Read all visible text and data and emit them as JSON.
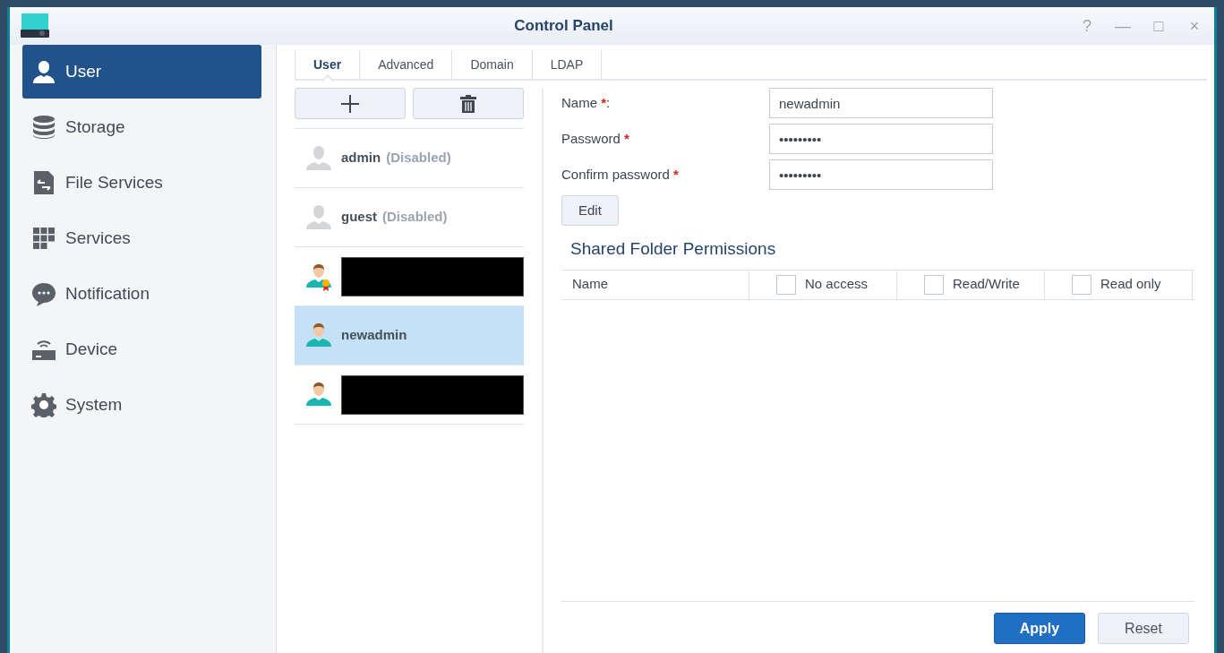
{
  "window": {
    "title": "Control Panel",
    "controls": [
      "?",
      "—",
      "□",
      "×"
    ]
  },
  "sidebar": {
    "items": [
      {
        "label": "User",
        "selected": true
      },
      {
        "label": "Storage",
        "selected": false
      },
      {
        "label": "File Services",
        "selected": false
      },
      {
        "label": "Services",
        "selected": false
      },
      {
        "label": "Notification",
        "selected": false
      },
      {
        "label": "Device",
        "selected": false
      },
      {
        "label": "System",
        "selected": false
      }
    ]
  },
  "tabs": [
    {
      "label": "User",
      "selected": true
    },
    {
      "label": "Advanced",
      "selected": false
    },
    {
      "label": "Domain",
      "selected": false
    },
    {
      "label": "LDAP",
      "selected": false
    }
  ],
  "users": [
    {
      "kind": "named",
      "name": "admin",
      "status": "(Disabled)",
      "enabled": false,
      "admin_badge": false,
      "selected": false
    },
    {
      "kind": "named",
      "name": "guest",
      "status": "(Disabled)",
      "enabled": false,
      "admin_badge": false,
      "selected": false
    },
    {
      "kind": "redacted",
      "enabled": true,
      "admin_badge": true,
      "selected": false
    },
    {
      "kind": "named",
      "name": "newadmin",
      "enabled": true,
      "admin_badge": false,
      "selected": true
    },
    {
      "kind": "redacted",
      "enabled": true,
      "admin_badge": false,
      "selected": false
    }
  ],
  "form": {
    "fields": [
      {
        "label": "Name",
        "required_mark": "*",
        "suffix": ":",
        "value": "newadmin"
      },
      {
        "label": "Password",
        "required_mark": "*",
        "value": "•••••••••"
      },
      {
        "label": "Confirm password",
        "required_mark": "*",
        "value": "•••••••••"
      }
    ],
    "edit_button": "Edit"
  },
  "permissions": {
    "title": "Shared Folder Permissions",
    "columns": [
      {
        "label": "Name",
        "kind": "text"
      },
      {
        "label": "No access",
        "kind": "check",
        "checked": false
      },
      {
        "label": "Read/Write",
        "kind": "check",
        "checked": false
      },
      {
        "label": "Read only",
        "kind": "check",
        "checked": false
      }
    ]
  },
  "buttons": {
    "apply": "Apply",
    "reset": "Reset"
  }
}
